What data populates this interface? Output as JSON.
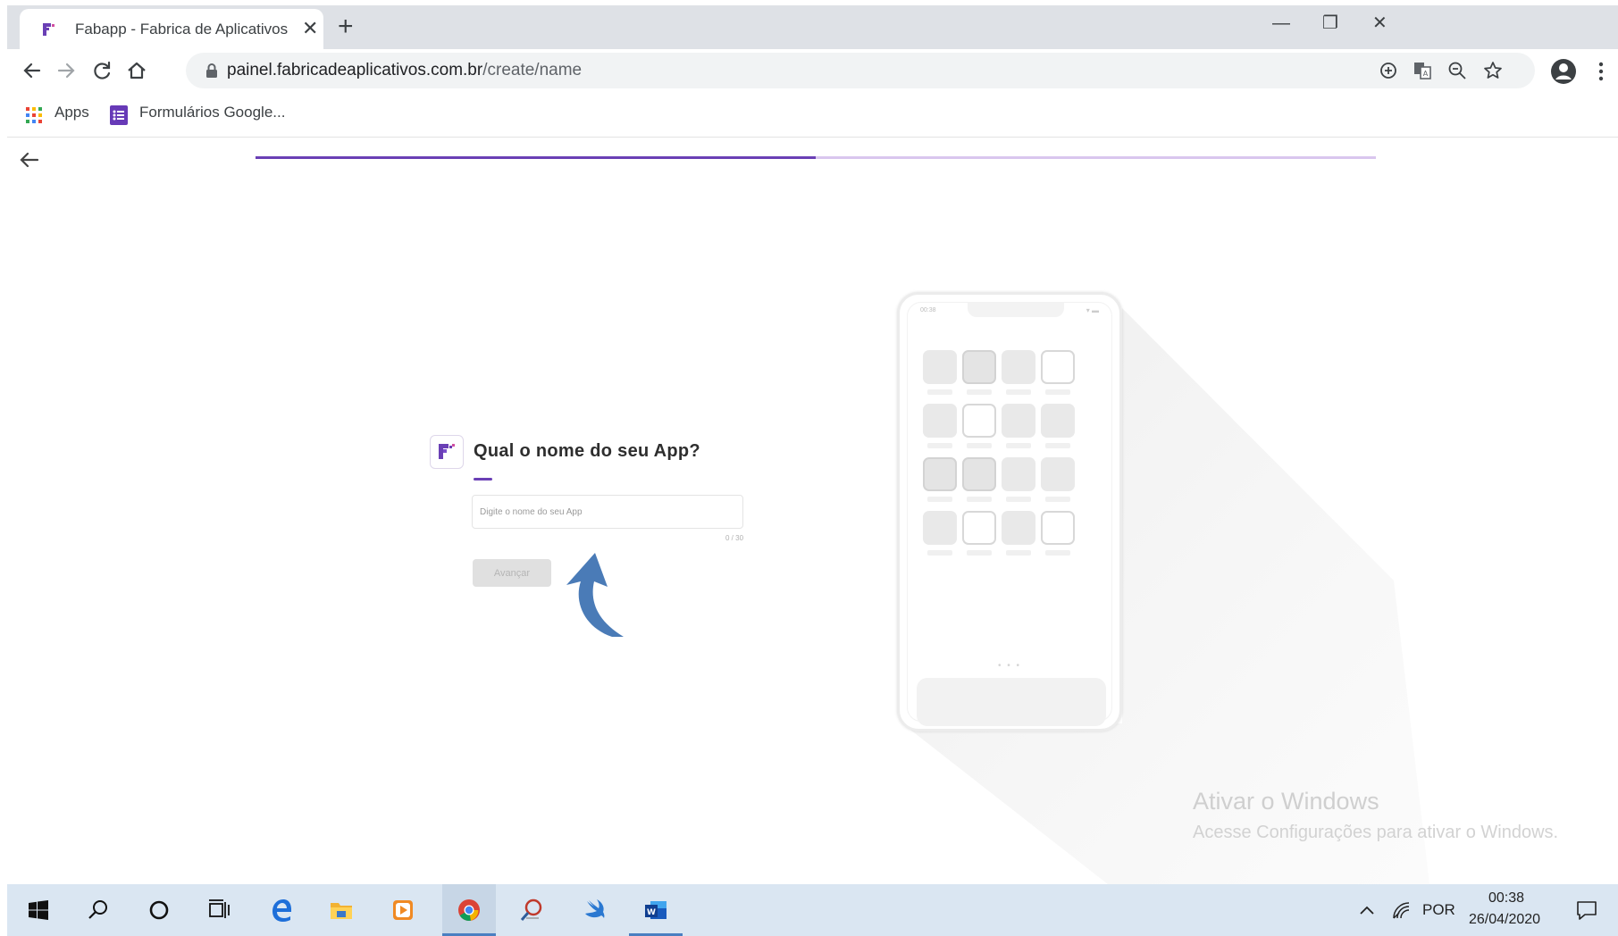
{
  "browser": {
    "tab_title": "Fabapp - Fabrica de Aplicativos",
    "url_host": "painel.fabricadeaplicativos.com.br",
    "url_path": "/create/name",
    "bookmarks": [
      {
        "label": "Apps",
        "icon": "apps-grid-icon"
      },
      {
        "label": "Formulários Google...",
        "icon": "google-forms-icon"
      }
    ],
    "window_controls": {
      "minimize": "—",
      "restore": "❐",
      "close": "✕"
    },
    "new_tab": "+",
    "tab_close": "✕"
  },
  "page": {
    "progress": 0.5,
    "form": {
      "title": "Qual o nome do seu App?",
      "input_placeholder": "Digite o nome do seu App",
      "input_value": "",
      "counter": "0 / 30",
      "next_button": "Avançar"
    },
    "phone_mockup": {
      "status_time": "00:38",
      "status_icons": "▾ ▬",
      "page_dots": "• • •",
      "icons": [
        [
          "filled",
          "filled-outlined",
          "filled",
          "outlined"
        ],
        [
          "filled",
          "outlined",
          "filled",
          "filled"
        ],
        [
          "filled-outlined",
          "filled-outlined",
          "filled",
          "filled"
        ],
        [
          "filled",
          "outlined",
          "filled",
          "outlined"
        ]
      ]
    },
    "watermark": {
      "title": "Ativar o Windows",
      "subtitle": "Acesse Configurações para ativar o Windows."
    }
  },
  "taskbar": {
    "apps": [
      "windows-start-icon",
      "search-icon",
      "cortana-icon",
      "task-view-icon",
      "edge-icon",
      "file-explorer-icon",
      "media-player-icon",
      "chrome-icon",
      "app-icon",
      "swift-icon",
      "word-icon"
    ],
    "tray": {
      "language": "POR",
      "time": "00:38",
      "date": "26/04/2020"
    }
  },
  "colors": {
    "accent": "#6a3fb5",
    "progress_track": "#d9c6ee",
    "annotation_arrow": "#4a7bb7",
    "taskbar": "#dae6f2"
  }
}
